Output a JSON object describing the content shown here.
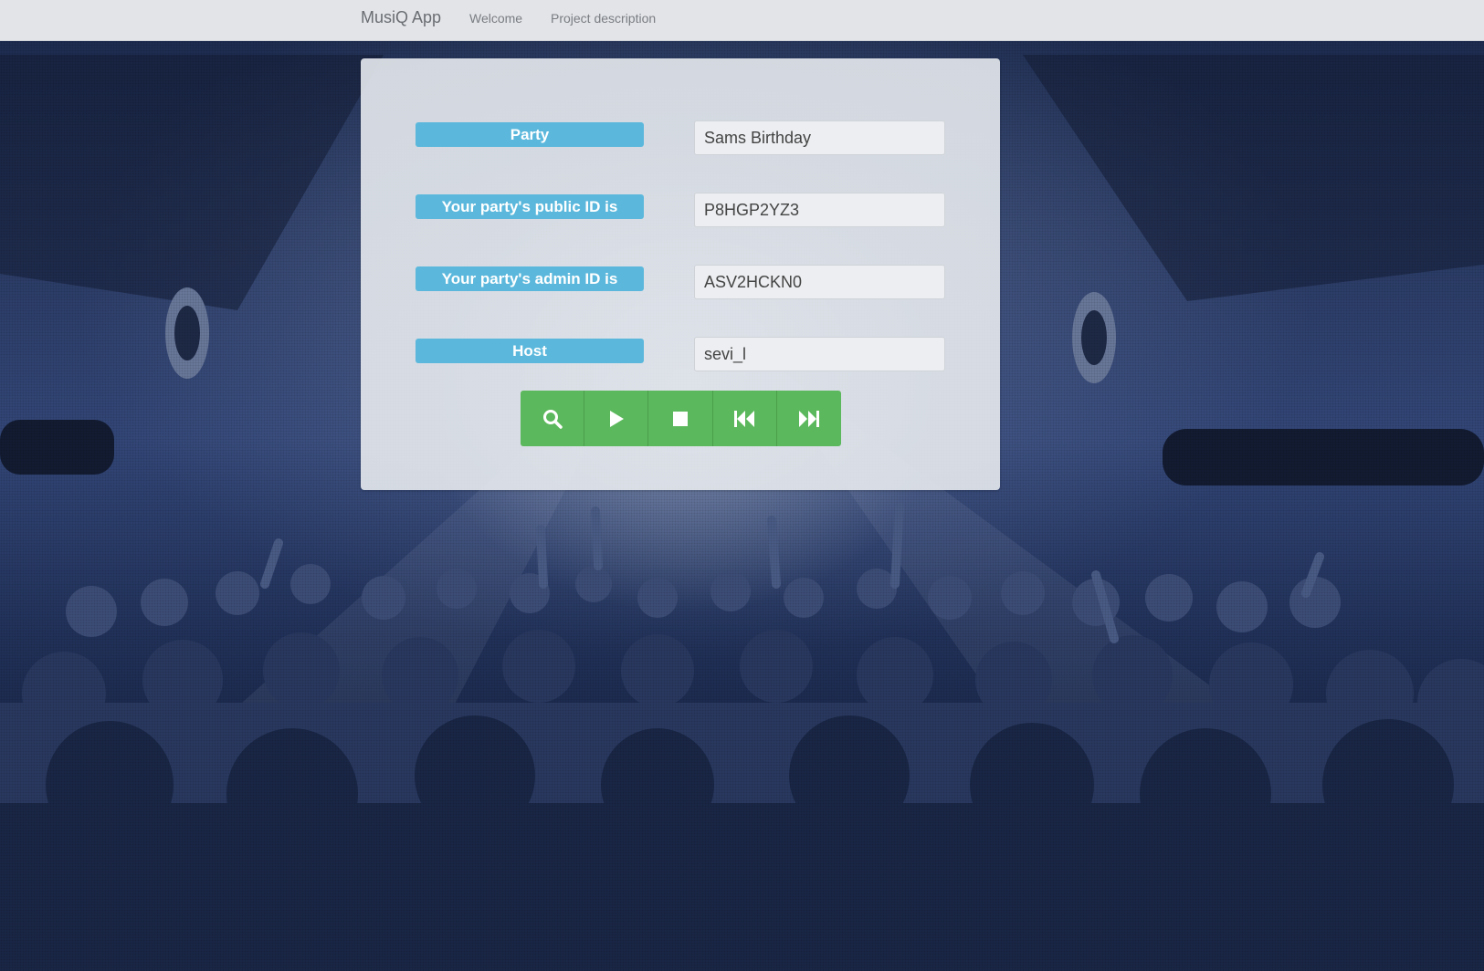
{
  "navbar": {
    "brand": "MusiQ App",
    "links": [
      {
        "label": "Welcome"
      },
      {
        "label": "Project description"
      }
    ]
  },
  "party_info": {
    "rows": [
      {
        "label": "Party",
        "value": "Sams Birthday"
      },
      {
        "label": "Your party's public ID is",
        "value": "P8HGP2YZ3"
      },
      {
        "label": "Your party's admin ID is",
        "value": "ASV2HCKN0"
      },
      {
        "label": "Host",
        "value": "sevi_l"
      }
    ]
  },
  "controls": {
    "buttons": [
      {
        "icon": "search-icon"
      },
      {
        "icon": "play-icon"
      },
      {
        "icon": "stop-icon"
      },
      {
        "icon": "skip-backward-icon"
      },
      {
        "icon": "skip-forward-icon"
      }
    ]
  },
  "colors": {
    "label_bg": "#5bb8dc",
    "control_bg": "#5cb85c",
    "navbar_bg": "#e2e4e8"
  }
}
